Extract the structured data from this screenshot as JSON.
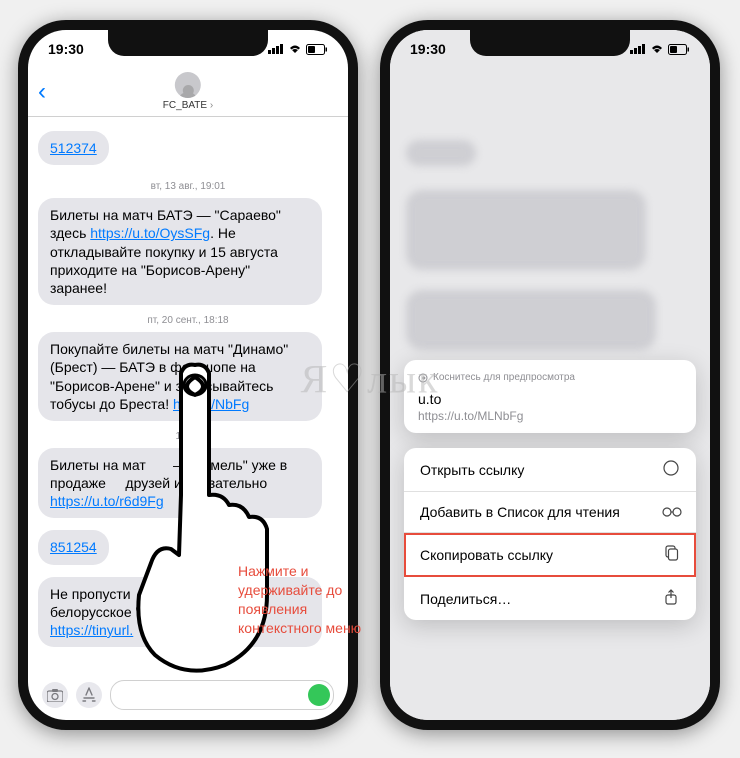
{
  "status": {
    "time": "19:30"
  },
  "nav": {
    "title": "FC_BATE"
  },
  "messages": {
    "link_single": "512374",
    "date1": "вт, 13 авг., 19:01",
    "msg1_part1": "Билеты на матч БАТЭ — \"Сараево\" здесь ",
    "msg1_link": "https://u.to/OysSFg",
    "msg1_part2": ". Не откладывайте покупку и 15 августа приходите на \"Борисов-Арену\" заранее!",
    "date2": "пт, 20 сент., 18:18",
    "msg2_part1": "Покупайте билеты на матч \"Динамо\" (Брест) — БАТЭ в фан-шопе на \"Борисов-Арене\" и записывайтесь ",
    "msg2_mid": "тобусы до Бреста! ",
    "msg2_link": "https://",
    "msg2_linktail": "NbFg",
    "date3": "18:01",
    "msg3_part1": "Билеты на мат",
    "msg3_part2": "— \"Гомель\" уже в продаже",
    "msg3_part3": "друзей и обязательно",
    "msg3_link": "https://u.to/r6d9Fg",
    "link_single2": "851254",
    "msg4_part1": "Не пропусти",
    "msg4_part2": "белорусское \"",
    "msg4_link": "https://tinyurl."
  },
  "caption": "Нажмите и удерживайте до появления контекстного меню",
  "preview": {
    "tap": "Коснитесь для предпросмотра",
    "domain": "u.to",
    "url": "https://u.to/MLNbFg"
  },
  "menu": {
    "open": "Открыть ссылку",
    "reading": "Добавить в Список для чтения",
    "copy": "Скопировать ссылку",
    "share": "Поделиться…"
  },
  "watermark": "Я♡лык"
}
